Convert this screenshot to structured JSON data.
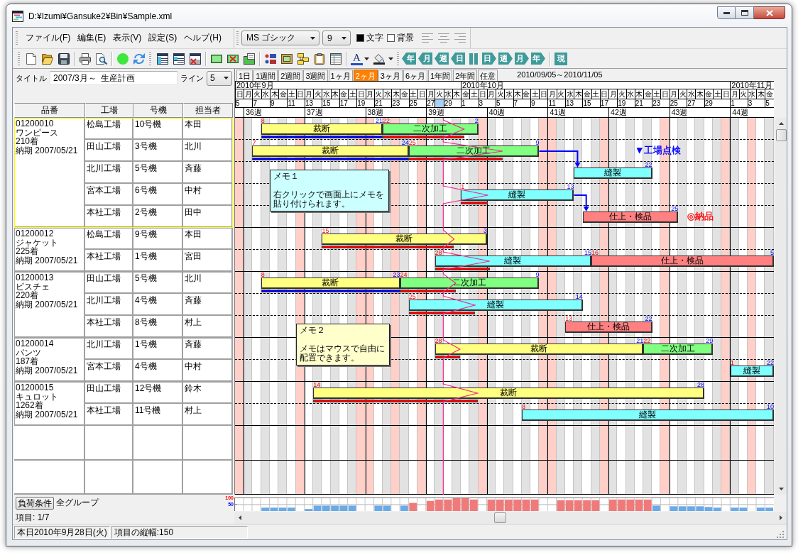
{
  "window": {
    "title": "D:¥Izumi¥Gansuke2¥Bin¥Sample.xml"
  },
  "menu": [
    "ファイル(F)",
    "編集(E)",
    "表示(V)",
    "設定(S)",
    "ヘルプ(H)"
  ],
  "format_toolbar": {
    "font": "MS ゴシック",
    "size": "9",
    "color_options": [
      {
        "label": "文字",
        "color": "#000000"
      },
      {
        "label": "背景",
        "color": "#ffffff"
      }
    ]
  },
  "toolbar": {
    "font_color": "A",
    "navigation": [
      {
        "kind": "back",
        "label": "年"
      },
      {
        "kind": "back",
        "label": "月"
      },
      {
        "kind": "back",
        "label": "週"
      },
      {
        "kind": "back",
        "label": "日"
      },
      {
        "kind": "pause"
      },
      {
        "kind": "forward",
        "label": "日"
      },
      {
        "kind": "forward",
        "label": "週"
      },
      {
        "kind": "forward",
        "label": "月"
      },
      {
        "kind": "forward",
        "label": "年"
      },
      {
        "kind": "today",
        "label": "現"
      }
    ]
  },
  "title_field": {
    "label": "タイトル",
    "value": "2007/3月～  生産計画"
  },
  "line_select": {
    "label": "ライン",
    "value": "5"
  },
  "period_tabs": [
    {
      "label": "1日",
      "selected": false
    },
    {
      "label": "1週間",
      "selected": false
    },
    {
      "label": "2週間",
      "selected": false
    },
    {
      "label": "3週間",
      "selected": false
    },
    {
      "label": "1ヶ月",
      "selected": false
    },
    {
      "label": "2ヶ月",
      "selected": true
    },
    {
      "label": "3ヶ月",
      "selected": false
    },
    {
      "label": "6ヶ月",
      "selected": false
    },
    {
      "label": "1年間",
      "selected": false
    },
    {
      "label": "2年間",
      "selected": false
    },
    {
      "label": "任意",
      "selected": false
    }
  ],
  "date_range": "2010/09/05～2010/11/05",
  "timeline": {
    "days": [
      {
        "weekday": "日",
        "date": "5",
        "month": "2010年9月",
        "holiday": true,
        "today": false
      },
      {
        "weekday": "月",
        "week": "36週",
        "holiday": false,
        "today": false
      },
      {
        "weekday": "火",
        "date": "7",
        "holiday": false,
        "today": false
      },
      {
        "weekday": "水",
        "holiday": false,
        "today": false
      },
      {
        "weekday": "木",
        "date": "9",
        "holiday": false,
        "today": false
      },
      {
        "weekday": "金",
        "holiday": false,
        "today": false
      },
      {
        "weekday": "土",
        "date": "11",
        "holiday": false,
        "today": false
      },
      {
        "weekday": "日",
        "holiday": true,
        "today": false
      },
      {
        "weekday": "月",
        "date": "13",
        "week": "37週",
        "holiday": false,
        "today": false
      },
      {
        "weekday": "火",
        "holiday": false,
        "today": false
      },
      {
        "weekday": "水",
        "date": "15",
        "holiday": false,
        "today": false
      },
      {
        "weekday": "木",
        "holiday": false,
        "today": false
      },
      {
        "weekday": "金",
        "date": "17",
        "holiday": false,
        "today": false
      },
      {
        "weekday": "土",
        "holiday": false,
        "today": false
      },
      {
        "weekday": "日",
        "date": "19",
        "holiday": true,
        "today": false
      },
      {
        "weekday": "月",
        "week": "38週",
        "holiday": true,
        "today": false
      },
      {
        "weekday": "火",
        "date": "21",
        "holiday": false,
        "today": false
      },
      {
        "weekday": "水",
        "holiday": false,
        "today": false
      },
      {
        "weekday": "木",
        "date": "23",
        "holiday": true,
        "today": false
      },
      {
        "weekday": "金",
        "holiday": false,
        "today": false
      },
      {
        "weekday": "土",
        "date": "25",
        "holiday": false,
        "today": false
      },
      {
        "weekday": "日",
        "holiday": true,
        "today": false
      },
      {
        "weekday": "月",
        "date": "27",
        "week": "39週",
        "holiday": false,
        "today": false
      },
      {
        "weekday": "火",
        "holiday": false,
        "today": true
      },
      {
        "weekday": "水",
        "date": "29",
        "holiday": false,
        "today": false
      },
      {
        "weekday": "木",
        "holiday": false,
        "today": false
      },
      {
        "weekday": "金",
        "date": "1",
        "month": "2010年10月",
        "holiday": false,
        "today": false
      },
      {
        "weekday": "土",
        "holiday": false,
        "today": false
      },
      {
        "weekday": "日",
        "date": "3",
        "holiday": true,
        "today": false
      },
      {
        "weekday": "月",
        "week": "40週",
        "holiday": false,
        "today": false
      },
      {
        "weekday": "火",
        "date": "5",
        "holiday": false,
        "today": false
      },
      {
        "weekday": "水",
        "holiday": false,
        "today": false
      },
      {
        "weekday": "木",
        "date": "7",
        "holiday": false,
        "today": false
      },
      {
        "weekday": "金",
        "holiday": false,
        "today": false
      },
      {
        "weekday": "土",
        "date": "9",
        "holiday": false,
        "today": false
      },
      {
        "weekday": "日",
        "holiday": true,
        "today": false
      },
      {
        "weekday": "月",
        "date": "11",
        "week": "41週",
        "holiday": true,
        "today": false
      },
      {
        "weekday": "火",
        "holiday": false,
        "today": false
      },
      {
        "weekday": "水",
        "date": "13",
        "holiday": false,
        "today": false
      },
      {
        "weekday": "木",
        "holiday": false,
        "today": false
      },
      {
        "weekday": "金",
        "date": "15",
        "holiday": false,
        "today": false
      },
      {
        "weekday": "土",
        "holiday": false,
        "today": false
      },
      {
        "weekday": "日",
        "date": "17",
        "holiday": true,
        "today": false
      },
      {
        "weekday": "月",
        "week": "42週",
        "holiday": false,
        "today": false
      },
      {
        "weekday": "火",
        "date": "19",
        "holiday": false,
        "today": false
      },
      {
        "weekday": "水",
        "holiday": false,
        "today": false
      },
      {
        "weekday": "木",
        "date": "21",
        "holiday": false,
        "today": false
      },
      {
        "weekday": "金",
        "holiday": false,
        "today": false
      },
      {
        "weekday": "土",
        "date": "23",
        "holiday": false,
        "today": false
      },
      {
        "weekday": "日",
        "holiday": true,
        "today": false
      },
      {
        "weekday": "月",
        "date": "25",
        "week": "43週",
        "holiday": false,
        "today": false
      },
      {
        "weekday": "火",
        "holiday": false,
        "today": false
      },
      {
        "weekday": "水",
        "date": "27",
        "holiday": false,
        "today": false
      },
      {
        "weekday": "木",
        "holiday": false,
        "today": false
      },
      {
        "weekday": "金",
        "date": "29",
        "holiday": false,
        "today": false
      },
      {
        "weekday": "土",
        "holiday": false,
        "today": false
      },
      {
        "weekday": "日",
        "holiday": true,
        "today": false
      },
      {
        "weekday": "月",
        "date": "1",
        "month": "2010年11月",
        "week": "44週",
        "holiday": false,
        "today": false
      },
      {
        "weekday": "火",
        "holiday": false,
        "today": false
      },
      {
        "weekday": "水",
        "date": "3",
        "holiday": true,
        "today": false
      },
      {
        "weekday": "木",
        "holiday": false,
        "today": false
      },
      {
        "weekday": "金",
        "date": "5",
        "holiday": false,
        "today": false
      }
    ]
  },
  "table": {
    "columns": [
      "品番",
      "工場",
      "号機",
      "担当者"
    ],
    "groups": [
      {
        "code": "01200010",
        "name": "ワンピース",
        "quantity": "210着",
        "due": "納期 2007/05/21",
        "selected": true,
        "rows": [
          {
            "factory": "松島工場",
            "machine": "10号機",
            "person": "本田",
            "tasks": [
              {
                "name": "裁断",
                "color": "#ffff80",
                "start_label": "8",
                "end_label": "21",
                "level": 1,
                "successor_arrow": false
              },
              {
                "name": "二次加工",
                "color": "#80ff80",
                "start_label": "22",
                "end_label": "2",
                "level": 0.85,
                "successor_arrow": false
              }
            ]
          },
          {
            "factory": "田山工場",
            "machine": "3号機",
            "person": "北川",
            "tasks": [
              {
                "name": "裁断",
                "color": "#ffff80",
                "start_label": "7",
                "end_label": "24",
                "level": 1,
                "successor_arrow": false
              },
              {
                "name": "二次加工",
                "color": "#80ff80",
                "start_label": "25",
                "end_label": "9",
                "level": 0.72,
                "successor_arrow": true
              }
            ],
            "markers": [
              {
                "text": "▼工場点検",
                "color": "#0000ff"
              }
            ]
          },
          {
            "factory": "北川工場",
            "machine": "5号機",
            "person": "斉藤",
            "tasks": [
              {
                "name": "縫製",
                "color": "#80ffff",
                "end_label": "22",
                "successor_arrow": false
              }
            ],
            "memo": {
              "title": "メモ１",
              "lines": [
                "右クリックで画面上にメモを",
                "貼り付けられます。"
              ],
              "color": "#ccffff"
            }
          },
          {
            "factory": "宮本工場",
            "machine": "6号機",
            "person": "中村",
            "tasks": [
              {
                "name": "縫製",
                "color": "#80ffff",
                "start_label": "1",
                "end_label": "13",
                "level": 0.24,
                "successor_arrow": true
              }
            ]
          },
          {
            "factory": "本社工場",
            "machine": "2号機",
            "person": "田中",
            "tasks": [
              {
                "name": "仕上・検品",
                "color": "#ff8080",
                "end_label": "25",
                "successor_arrow": false
              }
            ],
            "markers": [
              {
                "text": "◎納品",
                "color": "#ff0000"
              }
            ]
          }
        ]
      },
      {
        "code": "01200012",
        "name": "ジャケット",
        "quantity": "225着",
        "due": "納期 2007/05/21",
        "selected": false,
        "rows": [
          {
            "factory": "松島工場",
            "machine": "9号機",
            "person": "本田",
            "tasks": [
              {
                "name": "裁断",
                "color": "#ffff80",
                "start_label": "15",
                "end_label": "3",
                "level": 0.8,
                "successor_arrow": false
              }
            ]
          },
          {
            "factory": "本社工場",
            "machine": "1号機",
            "person": "宮田",
            "tasks": [
              {
                "name": "縫製",
                "color": "#80ffff",
                "start_label": "28",
                "end_label": "15",
                "level": 0.35,
                "successor_arrow": false
              },
              {
                "name": "仕上・検品",
                "color": "#ff8080",
                "start_label": "16",
                "end_label": "5",
                "successor_arrow": false
              }
            ]
          }
        ]
      },
      {
        "code": "01200013",
        "name": "ビスチェ",
        "quantity": "220着",
        "due": "納期 2007/05/21",
        "selected": false,
        "rows": [
          {
            "factory": "田山工場",
            "machine": "5号機",
            "person": "北川",
            "tasks": [
              {
                "name": "裁断",
                "color": "#ffff80",
                "start_label": "8",
                "end_label": "23",
                "level": 1,
                "successor_arrow": false
              },
              {
                "name": "二次加工",
                "color": "#80ff80",
                "start_label": "24",
                "end_label": "9",
                "level": 0.4,
                "successor_arrow": false
              }
            ]
          },
          {
            "factory": "北川工場",
            "machine": "4号機",
            "person": "斉藤",
            "tasks": [
              {
                "name": "縫製",
                "color": "#80ffff",
                "start_label": "25",
                "end_label": "14",
                "level": 0.38,
                "successor_arrow": false
              }
            ]
          },
          {
            "factory": "本社工場",
            "machine": "8号機",
            "person": "村上",
            "tasks": [
              {
                "name": "仕上・検品",
                "color": "#ff8080",
                "start_label": "13",
                "end_label": "22",
                "successor_arrow": false
              }
            ],
            "memo": {
              "title": "メモ２",
              "lines": [
                "メモはマウスで自由に",
                "配置できます。"
              ],
              "color": "#ffffcc"
            }
          }
        ]
      },
      {
        "code": "01200014",
        "name": "パンツ",
        "quantity": "187着",
        "due": "納期 2007/05/21",
        "selected": false,
        "rows": [
          {
            "factory": "北川工場",
            "machine": "1号機",
            "person": "斉藤",
            "tasks": [
              {
                "name": "裁断",
                "color": "#ffff80",
                "start_label": "28",
                "end_label": "21",
                "level": 0.12,
                "successor_arrow": false
              },
              {
                "name": "二次加工",
                "color": "#80ff80",
                "start_label": "22",
                "end_label": "29",
                "successor_arrow": false
              }
            ]
          },
          {
            "factory": "宮本工場",
            "machine": "4号機",
            "person": "中村",
            "tasks": [
              {
                "name": "縫製",
                "color": "#80ffff",
                "start_label": "1",
                "end_label": "22",
                "successor_arrow": false
              }
            ]
          }
        ]
      },
      {
        "code": "01200015",
        "name": "キュロット",
        "quantity": "1262着",
        "due": "納期 2007/05/21",
        "selected": false,
        "rows": [
          {
            "factory": "田山工場",
            "machine": "12号機",
            "person": "鈴木",
            "tasks": [
              {
                "name": "裁断",
                "color": "#ffff80",
                "start_label": "14",
                "end_label": "28",
                "level": 0.42,
                "successor_arrow": false
              }
            ]
          },
          {
            "factory": "本社工場",
            "machine": "11号機",
            "person": "村上",
            "tasks": [
              {
                "name": "縫製",
                "color": "#80ffff",
                "start_label": "8",
                "end_label": "10",
                "successor_arrow": false
              }
            ]
          }
        ]
      }
    ]
  },
  "load_panel": {
    "button": "負荷条件",
    "group": "全グループ",
    "chart_data": {
      "type": "bar",
      "values": [
        0,
        0,
        0,
        25,
        25,
        25,
        25,
        0,
        15,
        40,
        40,
        40,
        40,
        40,
        0,
        0,
        40,
        40,
        0,
        40,
        60,
        0,
        75,
        85,
        85,
        95,
        95,
        85,
        0,
        85,
        85,
        85,
        85,
        85,
        85,
        0,
        0,
        80,
        80,
        80,
        80,
        80,
        0,
        85,
        85,
        85,
        85,
        85,
        40,
        0,
        35,
        35,
        35,
        35,
        30,
        25,
        0,
        25,
        25,
        0,
        25,
        25
      ],
      "ylim": [
        0,
        100
      ],
      "yticks": [
        {
          "value": 100,
          "label": "100"
        },
        {
          "value": 50,
          "label": "50"
        }
      ],
      "ref_lines": [
        {
          "axis": "y",
          "value": 50
        }
      ]
    }
  },
  "item_count": "項目: 1/7",
  "status_bar": [
    "本日2010年9月28日(火)",
    "項目の縦幅:150"
  ]
}
